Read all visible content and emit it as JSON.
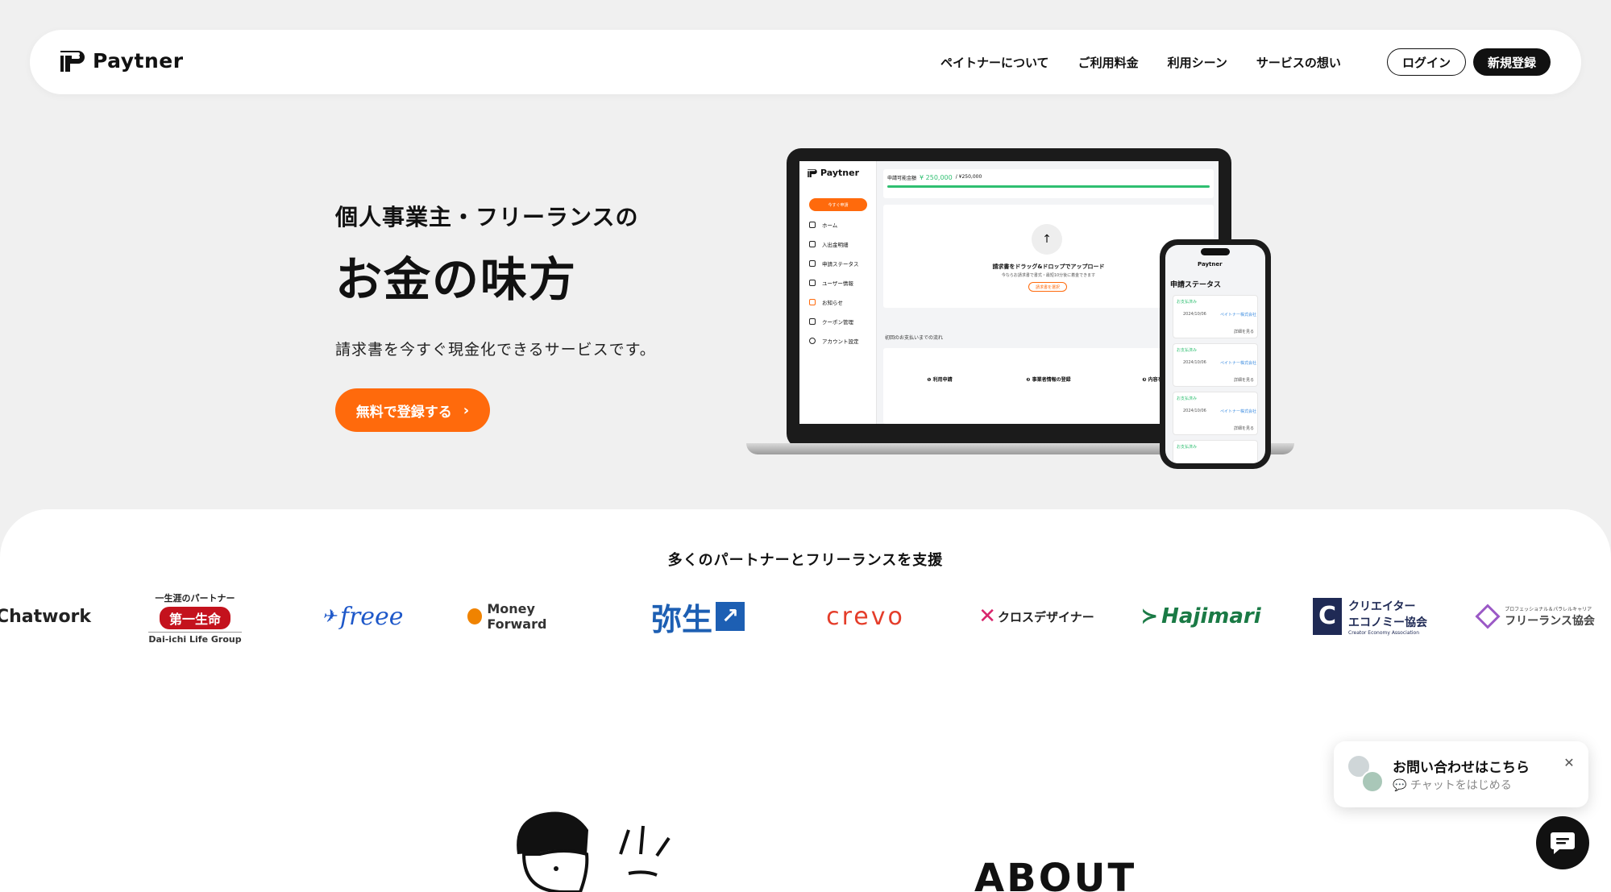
{
  "header": {
    "brand": "Paytner",
    "nav": [
      "ペイトナーについて",
      "ご利用料金",
      "利用シーン",
      "サービスの想い"
    ],
    "login_label": "ログイン",
    "register_label": "新規登録"
  },
  "hero": {
    "subtitle": "個人事業主・フリーランスの",
    "title": "お金の味方",
    "description": "請求書を今すぐ現金化できるサービスです。",
    "cta_label": "無料で登録する",
    "cta_color": "#ff6a0c"
  },
  "mockup": {
    "app_brand": "Paytner",
    "apply_button": "今すぐ申請",
    "limit_label": "申請可能金額",
    "limit_value": "¥ 250,000",
    "limit_total": "/ ¥250,000",
    "progress_pct": 100,
    "sidebar": [
      "ホーム",
      "入出金明細",
      "申請ステータス",
      "ユーザー情報",
      "お知らせ",
      "クーポン管理",
      "アカウント設定"
    ],
    "upload_title": "請求書をドラッグ&ドロップでアップロード",
    "upload_hint": "今ならお請求書で書式・最短10分後に着金できます",
    "upload_button": "請求書を選択",
    "flow_title": "初回のお支払いまでの流れ",
    "steps": [
      "❶ 利用申請",
      "❷ 事業者情報の登録",
      "❸ 内容を確認"
    ],
    "phone_title": "申請ステータス",
    "phone_status": "お支払済み",
    "phone_date": "2024/10/06",
    "phone_company": "ペイトナー株式会社",
    "phone_link": "詳細を見る"
  },
  "partners": {
    "heading": "多くのパートナーとフリーランスを支援",
    "logos": [
      "Chatwork",
      "第一生命",
      "freee",
      "Money Forward",
      "弥生",
      "crevo",
      "クロスデザイナー",
      "Hajimari",
      "クリエイターエコノミー協会",
      "フリーランス協会"
    ],
    "dai_ichi_top": "一生涯のパートナー",
    "dai_ichi_bottom": "Dai-ichi Life Group",
    "cea_line1": "クリエイター",
    "cea_line2": "エコノミー協会",
    "cea_sub": "Creator Economy Association",
    "fl_sub": "プロフェッショナル＆パラレルキャリア"
  },
  "about": {
    "heading": "ABOUT"
  },
  "chat": {
    "title": "お問い合わせはこちら",
    "subtitle": "チャットをはじめる"
  }
}
